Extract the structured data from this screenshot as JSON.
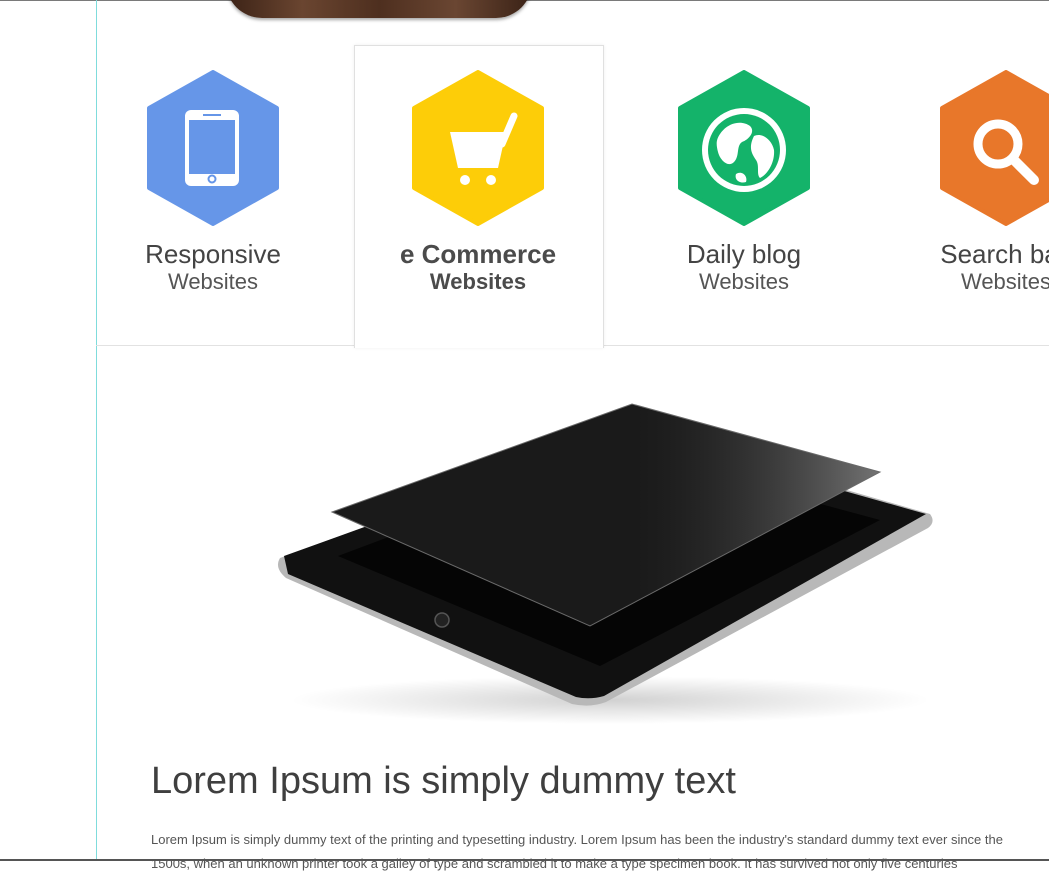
{
  "colors": {
    "responsive": "#6696e8",
    "ecommerce": "#fdcd08",
    "blog": "#14b36a",
    "search": "#e8772a",
    "guide": "#7fdcdc"
  },
  "tabs": [
    {
      "title": "Responsive",
      "subtitle": "Websites",
      "icon": "tablet-icon",
      "active": false
    },
    {
      "title": "e Commerce",
      "subtitle": "Websites",
      "icon": "shopping-cart-icon",
      "active": true
    },
    {
      "title": "Daily blog",
      "subtitle": "Websites",
      "icon": "globe-icon",
      "active": false
    },
    {
      "title": "Search bas",
      "subtitle": "Websites",
      "icon": "magnifier-icon",
      "active": false
    }
  ],
  "content": {
    "headline": "Lorem Ipsum is simply dummy text",
    "body": "Lorem Ipsum is simply dummy text of the printing and typesetting industry. Lorem Ipsum has been the industry's standard dummy text ever since the 1500s, when an unknown printer took a galley of type and scrambled it to make a type specimen book. It has survived not only five centuries"
  }
}
